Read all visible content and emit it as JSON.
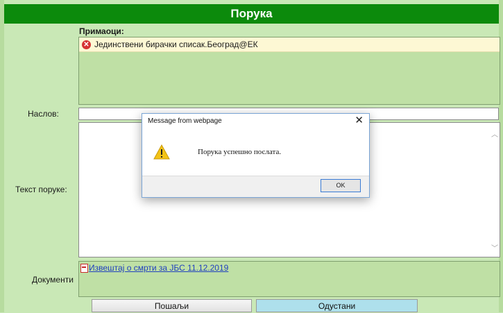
{
  "window": {
    "title": "Порука"
  },
  "recipients": {
    "label": "Примаоци:",
    "items": [
      {
        "name": "Јединствени бирачки списак.Београд@ЕК",
        "status_icon": "error-icon"
      }
    ]
  },
  "subject": {
    "label": "Наслов:",
    "value": ""
  },
  "body": {
    "label": "Текст поруке:",
    "value": ""
  },
  "documents": {
    "label": "Документи",
    "items": [
      {
        "name": "Извештај о смрти за ЈБС   11.12.2019",
        "icon": "pdf-icon"
      }
    ]
  },
  "buttons": {
    "send": "Пошаљи",
    "cancel": "Одустани"
  },
  "dialog": {
    "title": "Message from webpage",
    "message": "Порука успешно послата.",
    "ok_label": "OK",
    "close_glyph": "✕",
    "icon": "warning-icon"
  },
  "colors": {
    "title_bar": "#0c8a0c",
    "panel": "#c9e8b6",
    "cancel_button": "#aee0ec",
    "link": "#1f3fbf"
  }
}
